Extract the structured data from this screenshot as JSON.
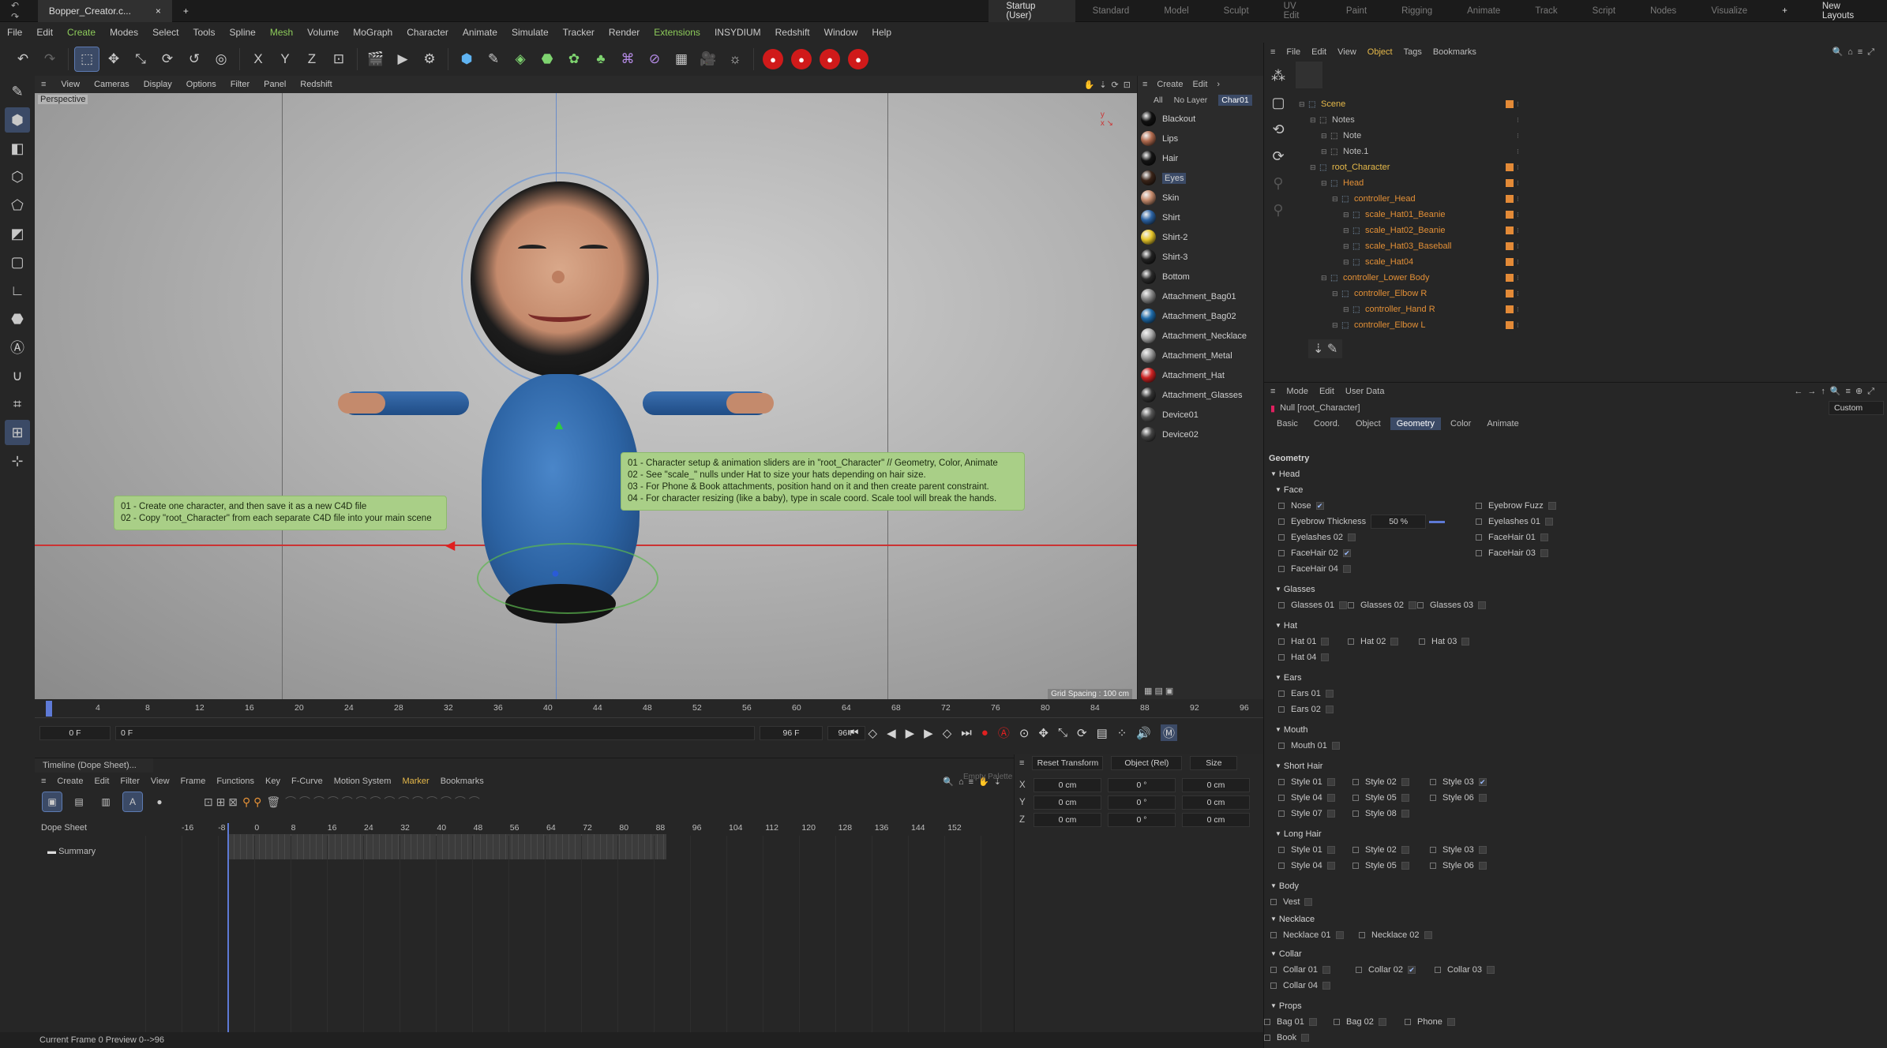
{
  "titlebar": {
    "doc_tab": "Bopper_Creator.c...",
    "layouts": [
      "Startup (User)",
      "Standard",
      "Model",
      "Sculpt",
      "UV Edit",
      "Paint",
      "Rigging",
      "Animate",
      "Track",
      "Script",
      "Nodes",
      "Visualize"
    ],
    "new_layouts": "New Layouts"
  },
  "menu": [
    "File",
    "Edit",
    "Create",
    "Modes",
    "Select",
    "Tools",
    "Spline",
    "Mesh",
    "Volume",
    "MoGraph",
    "Character",
    "Animate",
    "Simulate",
    "Tracker",
    "Render",
    "Extensions",
    "INSYDIUM",
    "Redshift",
    "Window",
    "Help"
  ],
  "viewport": {
    "menu": [
      "View",
      "Cameras",
      "Display",
      "Options",
      "Filter",
      "Panel",
      "Redshift"
    ],
    "label": "Perspective",
    "grid_spacing": "Grid Spacing : 100 cm",
    "note1": [
      "01 - Create one character, and then save it as a new C4D file",
      "02 - Copy \"root_Character\" from each separate C4D file into your main scene"
    ],
    "note2": [
      "01 - Character setup & animation sliders are in  \"root_Character\" // Geometry, Color, Animate",
      "02 - See \"scale_\" nulls under Hat to size your hats depending on hair size.",
      "03 - For Phone & Book attachments, position hand on it and then create parent constraint.",
      "04 - For character resizing (like a baby), type in scale coord. Scale tool will break the hands."
    ]
  },
  "materials": {
    "menu": [
      "Create",
      "Edit"
    ],
    "tabs": [
      "All",
      "No Layer",
      "Char01"
    ],
    "items": [
      "Blackout",
      "Lips",
      "Hair",
      "Eyes",
      "Skin",
      "Shirt",
      "Shirt-2",
      "Shirt-3",
      "Bottom",
      "Attachment_Bag01",
      "Attachment_Bag02",
      "Attachment_Necklace",
      "Attachment_Metal",
      "Attachment_Hat",
      "Attachment_Glasses",
      "Device01",
      "Device02"
    ],
    "selected": "Eyes"
  },
  "timeline": {
    "ticks": [
      "0",
      "4",
      "8",
      "12",
      "16",
      "20",
      "24",
      "28",
      "32",
      "36",
      "40",
      "44",
      "48",
      "52",
      "56",
      "60",
      "64",
      "68",
      "72",
      "76",
      "80",
      "84",
      "88",
      "92",
      "96"
    ],
    "start": "0 F",
    "cur": "0 F",
    "end": "96 F",
    "end2": "96 F"
  },
  "dopesheet": {
    "title": "Timeline (Dope Sheet)...",
    "menu": [
      "Create",
      "Edit",
      "Filter",
      "View",
      "Frame",
      "Functions",
      "Key",
      "F-Curve",
      "Motion System",
      "Marker",
      "Bookmarks"
    ],
    "empty": "Empty Palette",
    "label": "Dope Sheet",
    "summary": "Summary",
    "ticks": [
      "-16",
      "-8",
      "0",
      "8",
      "16",
      "24",
      "32",
      "40",
      "48",
      "56",
      "64",
      "72",
      "80",
      "88",
      "96",
      "104",
      "112",
      "120",
      "128",
      "136",
      "144",
      "152"
    ]
  },
  "coords": {
    "reset": "Reset Transform",
    "mode": "Object (Rel)",
    "size": "Size",
    "rows": [
      {
        "axis": "X",
        "a": "0 cm",
        "b": "0 °",
        "c": "0 cm"
      },
      {
        "axis": "Y",
        "a": "0 cm",
        "b": "0 °",
        "c": "0 cm"
      },
      {
        "axis": "Z",
        "a": "0 cm",
        "b": "0 °",
        "c": "0 cm"
      }
    ]
  },
  "status": "Current Frame  0  Preview  0-->96",
  "objects": {
    "menu": [
      "File",
      "Edit",
      "View",
      "Object",
      "Tags",
      "Bookmarks"
    ],
    "active_menu": "Object",
    "tree": [
      {
        "name": "Scene",
        "d": 0,
        "c": "y"
      },
      {
        "name": "Notes",
        "d": 1,
        "c": "w"
      },
      {
        "name": "Note",
        "d": 2,
        "c": "w"
      },
      {
        "name": "Note.1",
        "d": 2,
        "c": "w"
      },
      {
        "name": "root_Character",
        "d": 1,
        "c": "y"
      },
      {
        "name": "Head",
        "d": 2,
        "c": "o"
      },
      {
        "name": "controller_Head",
        "d": 3,
        "c": "o"
      },
      {
        "name": "scale_Hat01_Beanie",
        "d": 4,
        "c": "o"
      },
      {
        "name": "scale_Hat02_Beanie",
        "d": 4,
        "c": "o"
      },
      {
        "name": "scale_Hat03_Baseball",
        "d": 4,
        "c": "o"
      },
      {
        "name": "scale_Hat04",
        "d": 4,
        "c": "o"
      },
      {
        "name": "controller_Lower Body",
        "d": 2,
        "c": "o"
      },
      {
        "name": "controller_Elbow R",
        "d": 3,
        "c": "o"
      },
      {
        "name": "controller_Hand R",
        "d": 4,
        "c": "o"
      },
      {
        "name": "controller_Elbow L",
        "d": 3,
        "c": "o"
      }
    ]
  },
  "attributes": {
    "menu": [
      "Mode",
      "Edit",
      "User Data"
    ],
    "object": "Null [root_Character]",
    "preset": "Custom",
    "tabs": [
      "Basic",
      "Coord.",
      "Object",
      "Geometry",
      "Color",
      "Animate"
    ],
    "active_tab": "Geometry",
    "heading": "Geometry",
    "head": "Head",
    "face": "Face",
    "nose": "Nose",
    "eyebrow_fuzz": "Eyebrow Fuzz",
    "eyebrow_thickness": "Eyebrow Thickness",
    "eyebrow_value": "50 %",
    "eyelashes01": "Eyelashes 01",
    "eyelashes02": "Eyelashes 02",
    "facehair01": "FaceHair 01",
    "facehair02": "FaceHair 02",
    "facehair03": "FaceHair 03",
    "facehair04": "FaceHair 04",
    "glasses": "Glasses",
    "glasses_items": [
      "Glasses 01",
      "Glasses 02",
      "Glasses 03"
    ],
    "hat": "Hat",
    "hat_items": [
      "Hat 01",
      "Hat 02",
      "Hat 03",
      "Hat 04"
    ],
    "ears": "Ears",
    "ears_items": [
      "Ears 01",
      "Ears 02"
    ],
    "mouth": "Mouth",
    "mouth_items": [
      "Mouth 01"
    ],
    "short_hair": "Short Hair",
    "short_hair_items": [
      "Style 01",
      "Style 02",
      "Style 03",
      "Style 04",
      "Style 05",
      "Style 06",
      "Style 07",
      "Style 08"
    ],
    "long_hair": "Long Hair",
    "long_hair_items": [
      "Style 01",
      "Style 02",
      "Style 03",
      "Style 04",
      "Style 05",
      "Style 06"
    ],
    "body": "Body",
    "vest": "Vest",
    "necklace": "Necklace",
    "necklace_items": [
      "Necklace 01",
      "Necklace 02"
    ],
    "collar": "Collar",
    "collar_items": [
      "Collar 01",
      "Collar 02",
      "Collar 03",
      "Collar 04"
    ],
    "props": "Props",
    "props_items": [
      "Bag 01",
      "Bag 02",
      "Phone",
      "Book"
    ]
  },
  "colors": {
    "accent": "#3b4a66",
    "note": "#a9cf87",
    "yellow": "#e6b94a",
    "orange": "#e39037",
    "record": "#d01a1a"
  }
}
